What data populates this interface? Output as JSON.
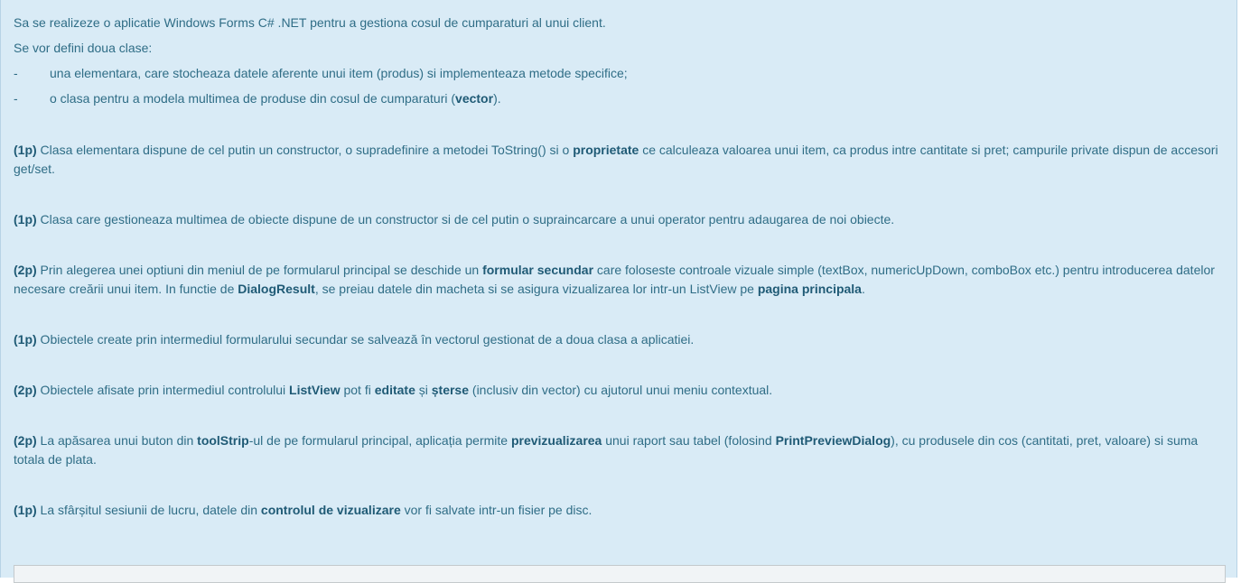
{
  "intro": [
    "Sa se realizeze o aplicatie Windows Forms C# .NET pentru a gestiona cosul de cumparaturi al unui client.",
    "Se vor defini doua clase:"
  ],
  "bullets": [
    {
      "dash": "-",
      "text": "una elementara, care stocheaza datele aferente unui item (produs) si implementeaza metode specifice;"
    },
    {
      "dash": "-",
      "text_before": "o clasa pentru a modela multimea de produse din cosul de cumparaturi (",
      "bold": "vector",
      "text_after": ")."
    }
  ],
  "requirements": [
    {
      "points": "(1p)",
      "t1": " Clasa elementara dispune de cel putin un constructor, o supradefinire a metodei ToString() si o ",
      "b1": "proprietate",
      "t2": " ce calculeaza valoarea unui item, ca produs intre cantitate si pret; campurile private dispun de accesori get/set."
    },
    {
      "points": "(1p)",
      "t1": " Clasa care gestioneaza multimea de obiecte dispune de un constructor si de cel putin o supraincarcare a unui operator pentru adaugarea de noi obiecte."
    },
    {
      "points": "(2p)",
      "t1": " Prin alegerea unei optiuni din meniul de pe formularul principal se deschide un ",
      "b1": "formular secundar",
      "t2": " care foloseste controale vizuale simple (textBox, numericUpDown, comboBox etc.) pentru introducerea datelor necesare creării unui item. In functie de ",
      "b2": "DialogResult",
      "t3": ", se preiau datele  din macheta si se asigura vizualizarea lor intr-un ListView pe ",
      "b3": "pagina principala",
      "t4": "."
    },
    {
      "points": "(1p)",
      "t1": " Obiectele create prin intermediul formularului secundar se salvează în vectorul gestionat de a doua clasa a aplicatiei."
    },
    {
      "points": "(2p)",
      "t1": " Obiectele afisate prin intermediul controlului ",
      "b1": "ListView",
      "t2": " pot fi ",
      "b2": "editate",
      "t3": " și ",
      "b3": "șterse",
      "t4": " (inclusiv din vector) cu ajutorul unui meniu contextual."
    },
    {
      "points": "(2p)",
      "t1": " La apăsarea unui buton din ",
      "b1": "toolStrip",
      "t2": "-ul de pe formularul principal, aplicația permite ",
      "b2": "previzualizarea",
      "t3": " unui raport sau tabel (folosind ",
      "b3": "PrintPreviewDialog",
      "t4": "), cu produsele din cos (cantitati, pret, valoare) si suma totala de plata."
    },
    {
      "points": "(1p)",
      "t1": " La sfârșitul sesiunii de lucru, datele din ",
      "b1": "controlul de vizualizare",
      "t2": " vor fi salvate intr-un fisier pe disc."
    }
  ],
  "colors": {
    "panel_background": "#d9ebf6",
    "text": "#2f6d86",
    "bold_text": "#1f5a75"
  }
}
